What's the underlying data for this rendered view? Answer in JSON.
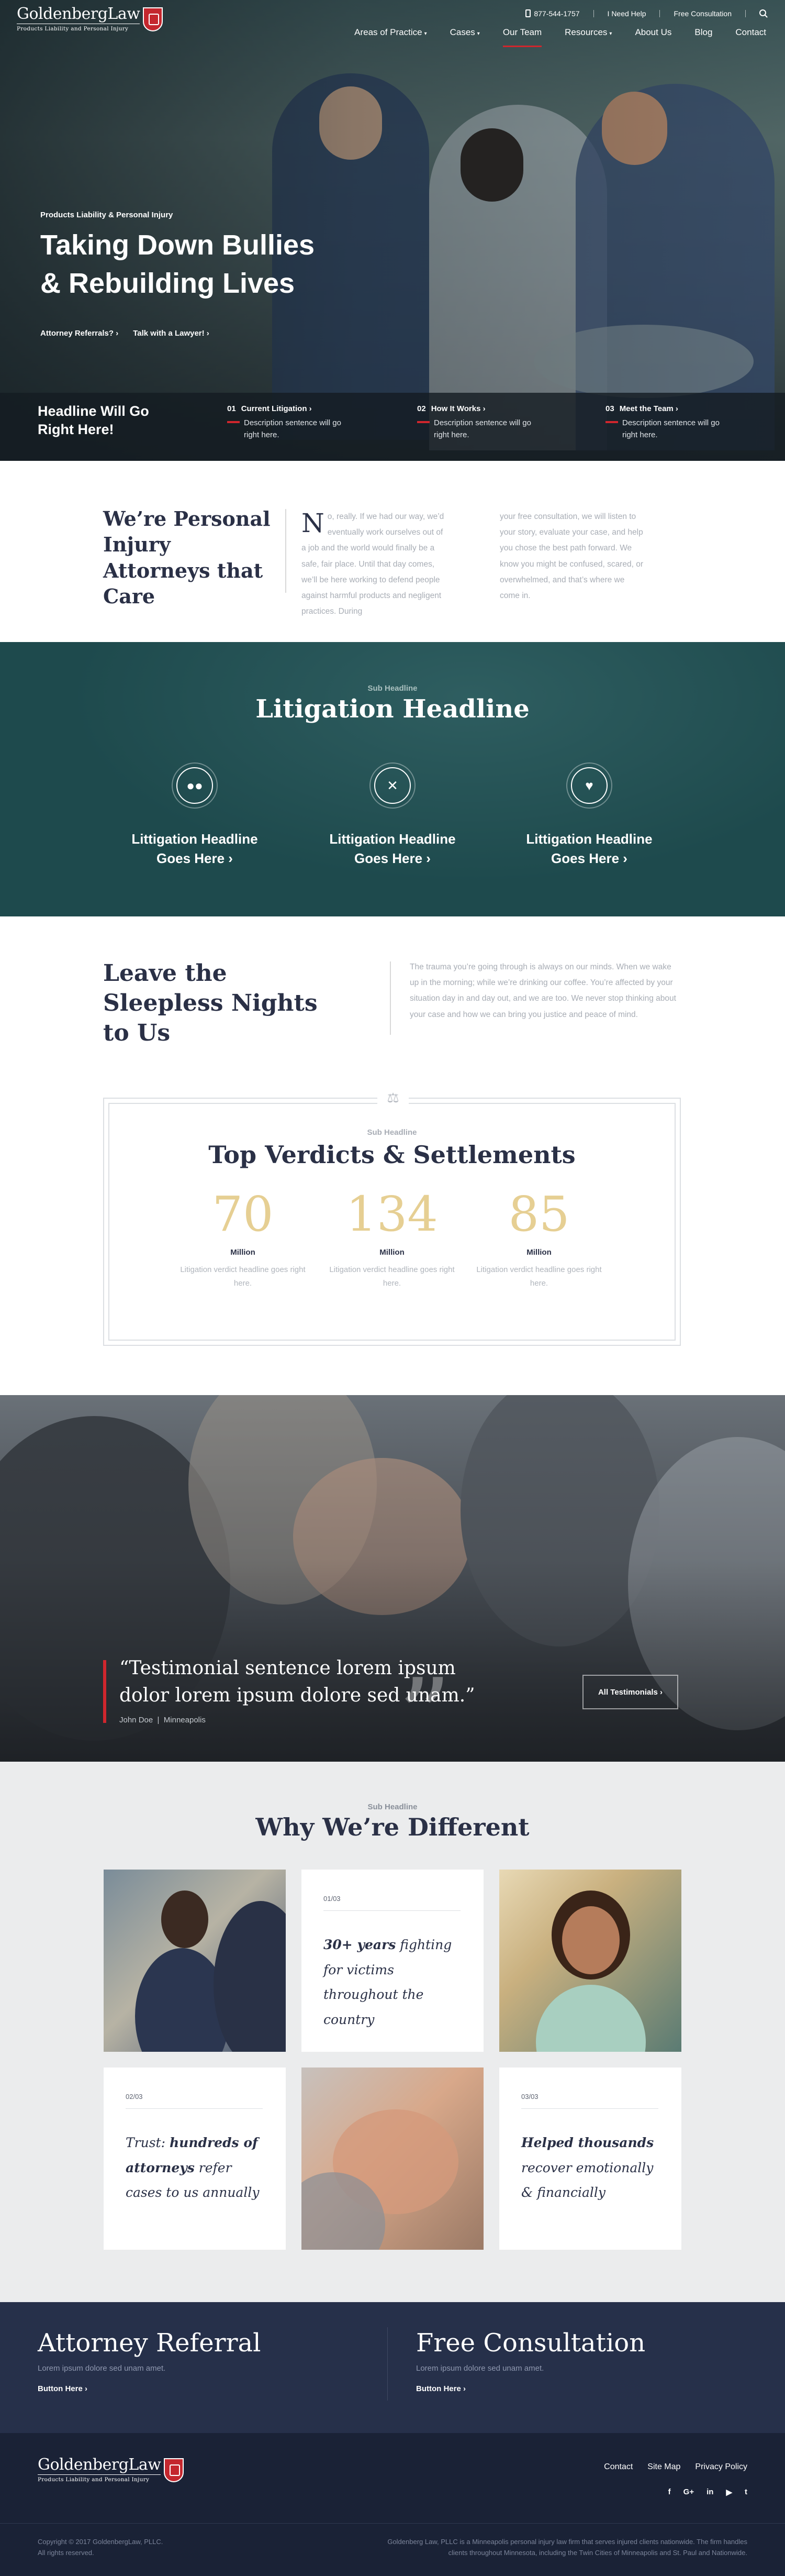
{
  "brand": {
    "name": "GoldenbergLaw",
    "tagline": "Products Liability and Personal Injury"
  },
  "topbar": {
    "phone": "877-544-1757",
    "help": "I Need Help",
    "consult": "Free Consultation"
  },
  "nav": [
    {
      "label": "Areas of Practice",
      "dropdown": true
    },
    {
      "label": "Cases",
      "dropdown": true
    },
    {
      "label": "Our Team",
      "dropdown": false
    },
    {
      "label": "Resources",
      "dropdown": true
    },
    {
      "label": "About Us",
      "dropdown": false
    },
    {
      "label": "Blog",
      "dropdown": false
    },
    {
      "label": "Contact",
      "dropdown": false
    }
  ],
  "hero": {
    "eyebrow": "Products Liability & Personal Injury",
    "title_line1": "Taking Down Bullies",
    "title_line2": "& Rebuilding Lives",
    "link1": "Attorney Referrals? ›",
    "link2": "Talk with a Lawyer! ›",
    "strip_title": "Headline Will Go Right Here!",
    "strip": [
      {
        "num": "01",
        "title": "Current Litigation ›",
        "desc": "Description sentence will go right here."
      },
      {
        "num": "02",
        "title": "How It Works ›",
        "desc": "Description sentence will go right here."
      },
      {
        "num": "03",
        "title": "Meet the Team ›",
        "desc": "Description sentence will go right here."
      }
    ]
  },
  "care": {
    "title": "We’re Personal Injury Attorneys that Care",
    "dropcap": "N",
    "col1": "o, really. If we had our way, we’d eventually work ourselves out of a job and the world would finally be a safe, fair place. Until that day comes, we’ll be here working to defend people against harmful products and negligent practices. During",
    "col2": "your free consultation, we will listen to your story, evaluate your case, and help you chose the best path forward. We know you might be confused, scared, or overwhelmed, and that’s where we come in."
  },
  "litigation": {
    "sub": "Sub Headline",
    "title": "Litigation Headline",
    "cards": [
      {
        "icon": "pills-icon",
        "label1": "Littigation Headline",
        "label2": "Goes Here ›"
      },
      {
        "icon": "utensils-icon",
        "label1": "Littigation Headline",
        "label2": "Goes Here ›"
      },
      {
        "icon": "heart-icon",
        "label1": "Littigation Headline",
        "label2": "Goes Here ›"
      }
    ]
  },
  "sleepless": {
    "title": "Leave the Sleepless Nights to Us",
    "text": "The trauma you’re going through is always on our minds. When we wake up in the morning; while we’re drinking our coffee. You’re affected by your situation day in and day out, and we are too. We never stop thinking about your case and how we can bring you justice and peace of mind."
  },
  "verdicts": {
    "sub": "Sub Headline",
    "title": "Top Verdicts & Settlements",
    "stats": [
      {
        "number": "70",
        "unit": "Million",
        "desc": "Litigation verdict headline goes right here."
      },
      {
        "number": "134",
        "unit": "Million",
        "desc": "Litigation verdict headline goes right here."
      },
      {
        "number": "85",
        "unit": "Million",
        "desc": "Litigation verdict headline goes right here."
      }
    ]
  },
  "testimonial": {
    "quote": "“Testimonial sentence lorem ipsum dolor lorem ipsum dolore sed unam.”",
    "name": "John Doe",
    "location": "Minneapolis",
    "button": "All Testimonials ›"
  },
  "why": {
    "sub": "Sub Headline",
    "title": "Why We’re Different",
    "cards": [
      {
        "num": "01/03",
        "bold": "30+ years",
        "rest": " fighting for victims throughout the country"
      },
      {
        "num": "02/03",
        "lead": "Trust: ",
        "bold": "hundreds of attorneys",
        "rest": " refer cases to us annually"
      },
      {
        "num": "03/03",
        "bold": "Helped thousands",
        "rest": " recover emotionally & financially"
      }
    ]
  },
  "cta": {
    "referral": {
      "title": "Attorney Referral",
      "desc": "Lorem ipsum dolore sed unam amet.",
      "button": "Button Here ›"
    },
    "consult": {
      "title": "Free Consultation",
      "desc": "Lorem ipsum dolore sed unam amet.",
      "button": "Button Here ›"
    }
  },
  "footer": {
    "links": [
      "Contact",
      "Site Map",
      "Privacy Policy"
    ],
    "social": [
      "f",
      "G+",
      "in",
      "▶",
      "t"
    ],
    "copyright": "Copyright © 2017 GoldenbergLaw, PLLC.",
    "rights": "All rights reserved.",
    "about": "Goldenberg Law, PLLC is a Minneapolis personal injury law firm that serves injured clients nationwide. The firm handles clients throughout Minnesota, including the Twin Cities of Minneapolis and St. Paul and Nationwide."
  },
  "colors": {
    "accent": "#d0262d",
    "teal": "#1e4a4d",
    "navy": "#26304a",
    "gold": "#e6cf93"
  }
}
